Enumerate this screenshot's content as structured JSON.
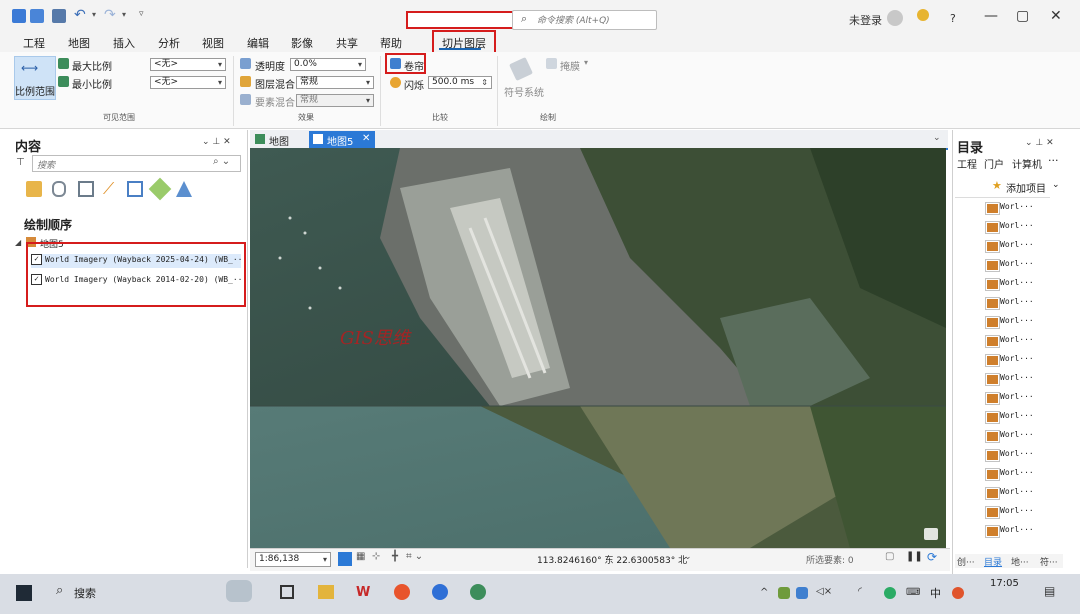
{
  "title_bar": {
    "command_search_placeholder": "命令搜索 (Alt+Q)",
    "signin": "未登录",
    "help": "?",
    "minimize": "—",
    "restore": "▢",
    "close": "✕"
  },
  "tabs": [
    "工程",
    "地图",
    "插入",
    "分析",
    "视图",
    "编辑",
    "影像",
    "共享",
    "帮助",
    "切片图层"
  ],
  "ribbon": {
    "visible_range": {
      "scale_range_label": "比例范围",
      "max_scale_label": "最大比例",
      "min_scale_label": "最小比例",
      "max_scale_value": "<无>",
      "min_scale_value": "<无>",
      "group_label": "可见范围"
    },
    "effects": {
      "transparency_label": "透明度",
      "transparency_value": "0.0%",
      "layer_blend_label": "图层混合",
      "layer_blend_value": "常规",
      "feature_blend_label": "要素混合",
      "feature_blend_value": "常规",
      "group_label": "效果"
    },
    "compare": {
      "swipe_label": "卷帘",
      "flicker_label": "闪烁",
      "flicker_value": "500.0  ms",
      "group_label": "比较"
    },
    "drawing": {
      "mask_label": "掩膜",
      "symbol_system_label": "符号系统",
      "group_label": "绘制"
    }
  },
  "contents_panel": {
    "title": "内容",
    "search_placeholder": "搜索",
    "drawing_order": "绘制顺序",
    "map_name": "地图5",
    "layers": [
      {
        "name": "World Imagery (Wayback 2025-04-24) (WB_···",
        "checked": true
      },
      {
        "name": "World Imagery (Wayback 2014-02-20) (WB_···",
        "checked": true
      }
    ]
  },
  "map_tabs": [
    {
      "label": "地图",
      "active": false
    },
    {
      "label": "地图5",
      "active": true
    }
  ],
  "map": {
    "watermark": "GIS思维"
  },
  "status_bar": {
    "scale": "1:86,138",
    "coordinates": "113.8246160° 东 22.6300583° 北",
    "selected_features": "所选要素: 0"
  },
  "catalog_panel": {
    "title": "目录",
    "tabs": [
      "工程",
      "门户",
      "计算机"
    ],
    "add_item": "添加项目",
    "items": [
      "Worl···",
      "Worl···",
      "Worl···",
      "Worl···",
      "Worl···",
      "Worl···",
      "Worl···",
      "Worl···",
      "Worl···",
      "Worl···",
      "Worl···",
      "Worl···",
      "Worl···",
      "Worl···",
      "Worl···",
      "Worl···",
      "Worl···",
      "Worl···"
    ],
    "bottom_tabs": [
      "创···",
      "目录",
      "地···",
      "符···"
    ]
  },
  "taskbar": {
    "search_label": "搜索",
    "time": "17:05",
    "ime": "中"
  },
  "colors": {
    "accent": "#2b79d6",
    "highlight_red": "#d51c1c",
    "ribbon_bg": "#fafafa"
  }
}
